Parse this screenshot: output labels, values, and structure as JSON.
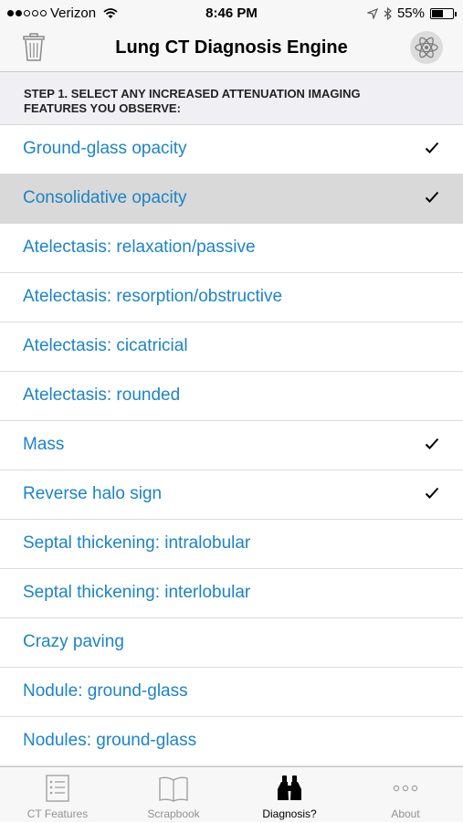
{
  "status_bar": {
    "carrier": "Verizon",
    "time": "8:46 PM",
    "battery": "55%",
    "battery_level": 0.55
  },
  "navbar": {
    "title": "Lung CT Diagnosis Engine",
    "left_icon": "trash-icon",
    "right_icon": "atom-icon"
  },
  "section_header": "STEP 1. SELECT ANY INCREASED ATTENUATION IMAGING FEATURES YOU OBSERVE:",
  "items": [
    {
      "label": "Ground-glass opacity",
      "checked": true,
      "highlighted": false
    },
    {
      "label": "Consolidative opacity",
      "checked": true,
      "highlighted": true
    },
    {
      "label": "Atelectasis: relaxation/passive",
      "checked": false,
      "highlighted": false
    },
    {
      "label": "Atelectasis: resorption/obstructive",
      "checked": false,
      "highlighted": false
    },
    {
      "label": "Atelectasis: cicatricial",
      "checked": false,
      "highlighted": false
    },
    {
      "label": "Atelectasis: rounded",
      "checked": false,
      "highlighted": false
    },
    {
      "label": "Mass",
      "checked": true,
      "highlighted": false
    },
    {
      "label": "Reverse halo sign",
      "checked": true,
      "highlighted": false
    },
    {
      "label": "Septal thickening: intralobular",
      "checked": false,
      "highlighted": false
    },
    {
      "label": "Septal thickening: interlobular",
      "checked": false,
      "highlighted": false
    },
    {
      "label": "Crazy paving",
      "checked": false,
      "highlighted": false
    },
    {
      "label": "Nodule: ground-glass",
      "checked": false,
      "highlighted": false
    },
    {
      "label": "Nodules: ground-glass",
      "checked": false,
      "highlighted": false
    }
  ],
  "tabbar": {
    "tabs": [
      {
        "label": "CT Features",
        "icon": "list-icon",
        "active": false
      },
      {
        "label": "Scrapbook",
        "icon": "book-icon",
        "active": false
      },
      {
        "label": "Diagnosis?",
        "icon": "binoculars-icon",
        "active": true
      },
      {
        "label": "About",
        "icon": "more-icon",
        "active": false
      }
    ]
  },
  "colors": {
    "link": "#1c84c6",
    "highlight": "#d9d9d9",
    "header_bg": "#efeff4"
  }
}
